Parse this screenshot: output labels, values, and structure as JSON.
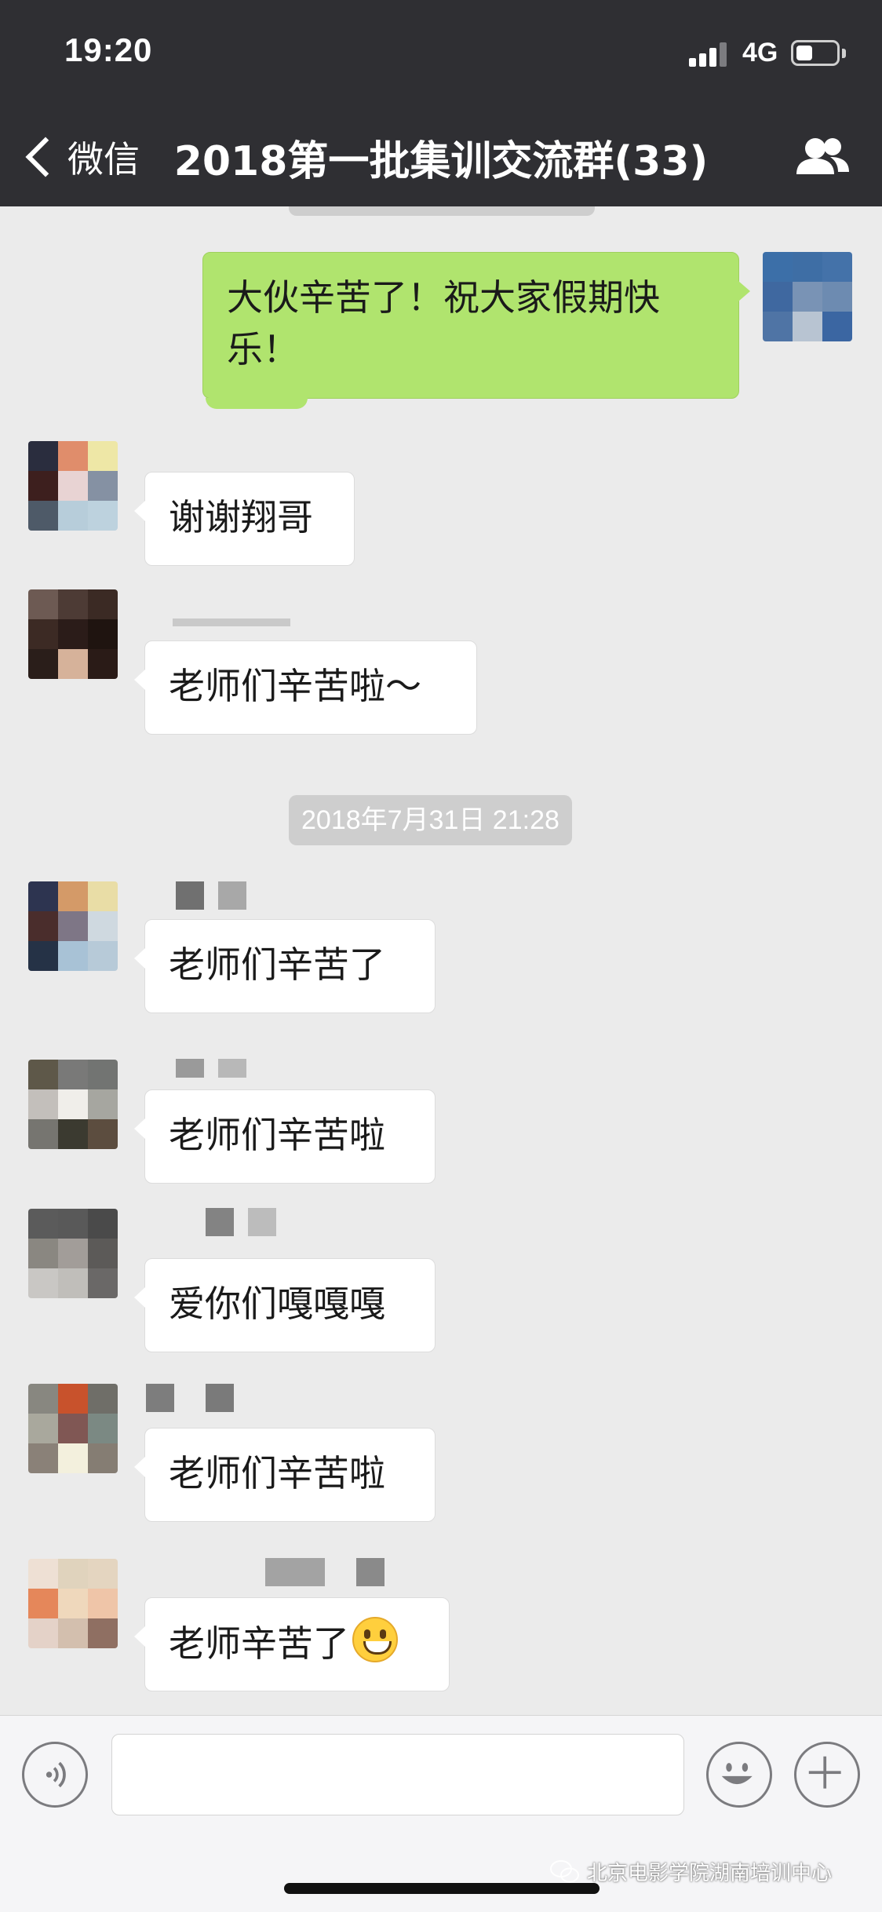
{
  "status_bar": {
    "time": "19:20",
    "network": "4G"
  },
  "nav": {
    "back_label": "微信",
    "title": "2018第一批集训交流群(33)"
  },
  "timestamps": {
    "second": "2018年7月31日 21:28"
  },
  "messages": [
    {
      "text": "大伙辛苦了！祝大家假期快乐！",
      "direction": "outgoing"
    },
    {
      "text": "谢谢翔哥",
      "direction": "incoming"
    },
    {
      "text": "老师们辛苦啦～",
      "direction": "incoming"
    },
    {
      "text": "老师们辛苦了",
      "direction": "incoming"
    },
    {
      "text": "老师们辛苦啦",
      "direction": "incoming"
    },
    {
      "text": "爱你们嘎嘎嘎",
      "direction": "incoming"
    },
    {
      "text": "老师们辛苦啦",
      "direction": "incoming"
    },
    {
      "text": "老师辛苦了",
      "direction": "incoming",
      "emoji": "grinning-face"
    }
  ],
  "watermark": {
    "text": "北京电影学院湖南培训中心"
  },
  "colors": {
    "nav_bg": "#2f2f33",
    "chat_bg": "#ebebeb",
    "outgoing_bubble": "#b0e46e",
    "incoming_bubble": "#ffffff"
  },
  "icons": [
    "back-chevron-icon",
    "group-members-icon",
    "voice-icon",
    "emoji-icon",
    "plus-icon",
    "wechat-logo-icon"
  ]
}
